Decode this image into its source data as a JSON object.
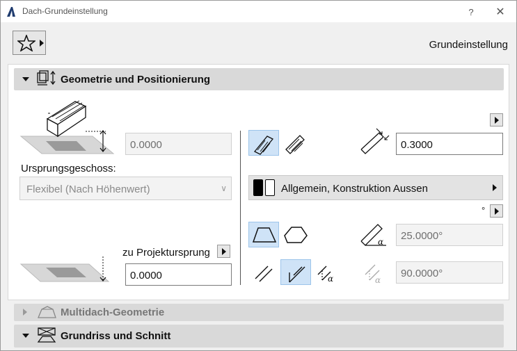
{
  "window": {
    "title": "Dach-Grundeinstellung",
    "help": "?",
    "close": "✕"
  },
  "favorites": {
    "label": "Grundeinstellung"
  },
  "sections": {
    "geometry": {
      "label": "Geometrie und Positionierung"
    },
    "multiroof": {
      "label": "Multidach-Geometrie"
    },
    "plan": {
      "label": "Grundriss und Schnitt"
    }
  },
  "geometry": {
    "height_value": "0.0000",
    "home_story_label": "Ursprungsgeschoss:",
    "home_story_value": "Flexibel (Nach Höhenwert)",
    "projection_label": "zu Projektursprung",
    "projection_value": "0.0000",
    "thickness_value": "0.3000",
    "material_label": "Allgemein, Konstruktion Aussen",
    "degree_symbol": "°",
    "pitch_value": "25.0000°",
    "angle_value": "90.0000°"
  },
  "colors": {
    "selected": "#cfe3f7",
    "header": "#d9d9d9"
  }
}
